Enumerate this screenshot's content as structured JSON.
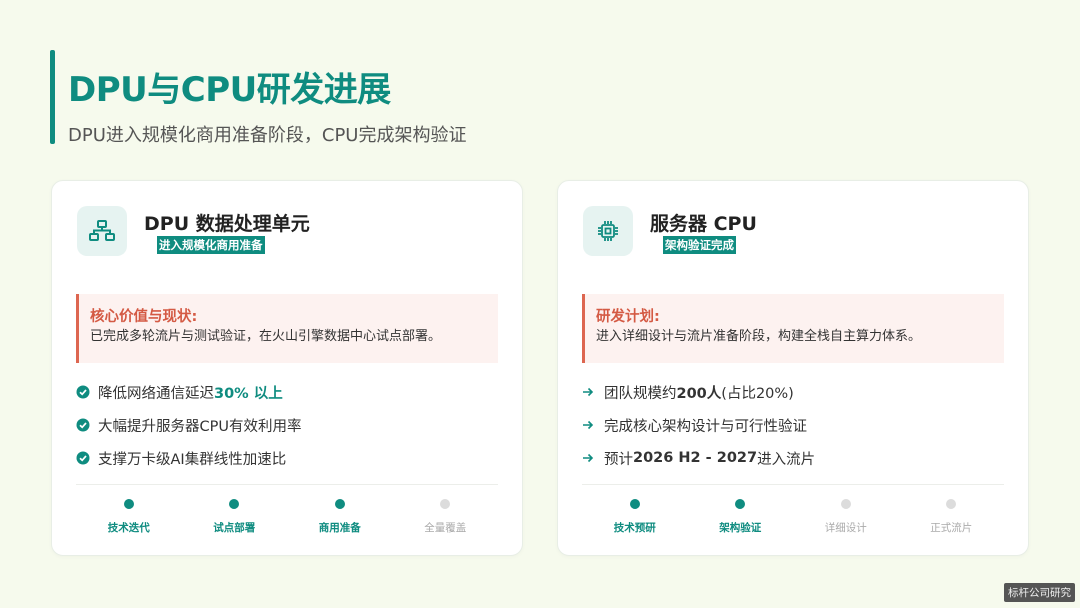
{
  "header": {
    "title": "DPU与CPU研发进展",
    "subtitle": "DPU进入规模化商用准备阶段，CPU完成架构验证"
  },
  "colors": {
    "accent": "#0f8c80",
    "callout": "#d45a44",
    "inactive": "#dcdcdc"
  },
  "cards": [
    {
      "icon": "network-icon",
      "title": "DPU 数据处理单元",
      "tag": "进入规模化商用准备",
      "callout_title": "核心价值与现状:",
      "callout_text": "已完成多轮流片与测试验证，在火山引擎数据中心试点部署。",
      "points": [
        {
          "pre": "降低网络通信延迟",
          "highlight": "30% 以上"
        },
        {
          "pre": "大幅提升服务器CPU有效利用率"
        },
        {
          "pre": "支撑万卡级AI集群线性加速比"
        }
      ],
      "timeline": [
        {
          "label": "技术迭代",
          "done": true
        },
        {
          "label": "试点部署",
          "done": true
        },
        {
          "label": "商用准备",
          "done": true
        },
        {
          "label": "全量覆盖",
          "done": false
        }
      ]
    },
    {
      "icon": "chip-icon",
      "title": "服务器 CPU",
      "tag": "架构验证完成",
      "callout_title": "研发计划:",
      "callout_text": "进入详细设计与流片准备阶段，构建全栈自主算力体系。",
      "points": [
        {
          "pre": "团队规模约",
          "bold": "200人",
          "post": " (占比20%)"
        },
        {
          "pre": "完成核心架构设计与可行性验证"
        },
        {
          "pre": "预计",
          "bold": "2026 H2 - 2027",
          "post": "进入流片"
        }
      ],
      "timeline": [
        {
          "label": "技术预研",
          "done": true
        },
        {
          "label": "架构验证",
          "done": true
        },
        {
          "label": "详细设计",
          "done": false
        },
        {
          "label": "正式流片",
          "done": false
        }
      ]
    }
  ],
  "watermark": "标杆公司研究"
}
